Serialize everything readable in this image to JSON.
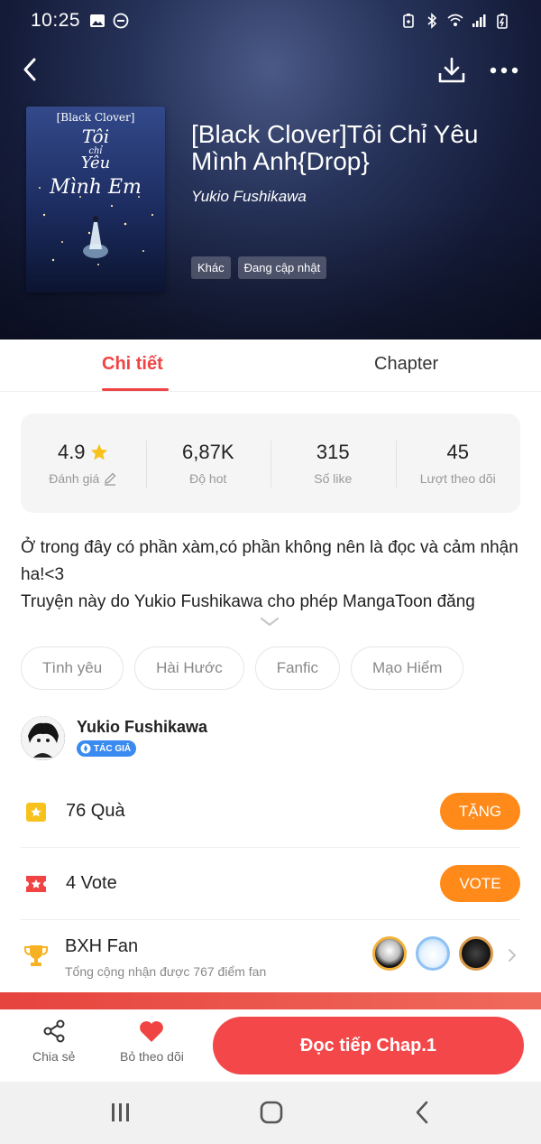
{
  "status_bar": {
    "time": "10:25"
  },
  "book": {
    "title": "[Black Clover]Tôi Chỉ Yêu Mình Anh{Drop}",
    "author": "Yukio Fushikawa",
    "tags": [
      "Khác",
      "Đang cập nhật"
    ],
    "cover_text": "[Black Clover] Tôi chỉ Yêu Mình Em"
  },
  "tabs": [
    {
      "label": "Chi tiết",
      "active": true
    },
    {
      "label": "Chapter",
      "active": false
    }
  ],
  "stats": [
    {
      "value": "4.9",
      "label": "Đánh giá"
    },
    {
      "value": "6,87K",
      "label": "Độ hot"
    },
    {
      "value": "315",
      "label": "Số like"
    },
    {
      "value": "45",
      "label": "Lượt theo dõi"
    }
  ],
  "description": {
    "line1": "Ở trong đây có phần xàm,có phần không nên là đọc và cảm nhận ha!<3",
    "line2": "Truyện này do Yukio Fushikawa cho phép MangaToon đăng"
  },
  "genres": [
    "Tình yêu",
    "Hài Hước",
    "Fanfic",
    "Mạo Hiểm"
  ],
  "author_block": {
    "name": "Yukio Fushikawa",
    "badge": "TÁC GIẢ"
  },
  "gift": {
    "text": "76 Quà",
    "button": "TẶNG"
  },
  "vote": {
    "text": "4 Vote",
    "button": "VOTE"
  },
  "fan_rank": {
    "title": "BXH Fan",
    "subtitle": "Tổng cộng nhận được 767 điểm fan"
  },
  "bottom_bar": {
    "share_label": "Chia sẻ",
    "follow_label": "Bỏ theo dõi",
    "read_button": "Đọc tiếp Chap.1"
  },
  "colors": {
    "accent": "#f04343",
    "orange": "#ff8a1a",
    "read_button": "#f3474a",
    "badge_blue": "#3a8bf0"
  }
}
